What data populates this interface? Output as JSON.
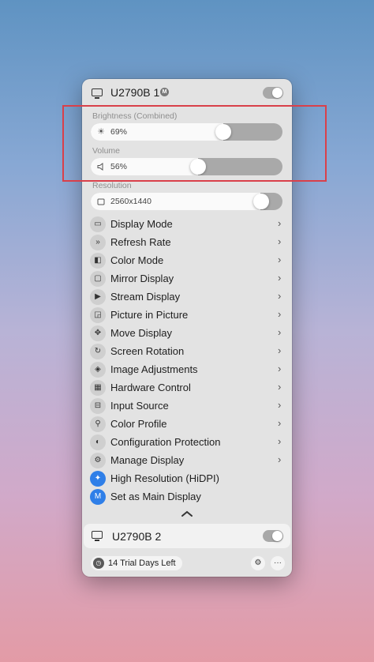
{
  "display1": {
    "name": "U2790B 1",
    "badge": "M",
    "enabled": true
  },
  "brightness": {
    "label": "Brightness (Combined)",
    "value_text": "69%",
    "level": 0.69,
    "icon": "sun-icon"
  },
  "volume": {
    "label": "Volume",
    "value_text": "56%",
    "level": 0.56,
    "icon": "speaker-icon"
  },
  "resolution": {
    "label": "Resolution",
    "value_text": "2560x1440",
    "icon": "resolution-icon"
  },
  "menu": [
    {
      "label": "Display Mode",
      "icon": "display-mode-icon",
      "glyph": "▭",
      "submenu": true
    },
    {
      "label": "Refresh Rate",
      "icon": "refresh-rate-icon",
      "glyph": "»",
      "submenu": true
    },
    {
      "label": "Color Mode",
      "icon": "color-mode-icon",
      "glyph": "◧",
      "submenu": true
    },
    {
      "label": "Mirror Display",
      "icon": "mirror-display-icon",
      "glyph": "▢",
      "submenu": true
    },
    {
      "label": "Stream Display",
      "icon": "stream-display-icon",
      "glyph": "▶",
      "submenu": true
    },
    {
      "label": "Picture in Picture",
      "icon": "picture-in-picture-icon",
      "glyph": "◲",
      "submenu": true
    },
    {
      "label": "Move Display",
      "icon": "move-display-icon",
      "glyph": "✥",
      "submenu": true
    },
    {
      "label": "Screen Rotation",
      "icon": "screen-rotation-icon",
      "glyph": "↻",
      "submenu": true
    },
    {
      "label": "Image Adjustments",
      "icon": "image-adjustments-icon",
      "glyph": "◈",
      "submenu": true
    },
    {
      "label": "Hardware Control",
      "icon": "hardware-control-icon",
      "glyph": "▦",
      "submenu": true
    },
    {
      "label": "Input Source",
      "icon": "input-source-icon",
      "glyph": "⊟",
      "submenu": true
    },
    {
      "label": "Color Profile",
      "icon": "color-profile-icon",
      "glyph": "⚲",
      "submenu": true
    },
    {
      "label": "Configuration Protection",
      "icon": "configuration-protection-icon",
      "glyph": "◐",
      "submenu": true
    },
    {
      "label": "Manage Display",
      "icon": "manage-display-icon",
      "glyph": "⚙",
      "submenu": true
    },
    {
      "label": "High Resolution (HiDPI)",
      "icon": "hidpi-icon",
      "glyph": "✦",
      "submenu": false,
      "accent": true
    },
    {
      "label": "Set as Main Display",
      "icon": "main-display-icon",
      "glyph": "M",
      "submenu": false,
      "accent": true
    }
  ],
  "display2": {
    "name": "U2790B 2",
    "enabled": true
  },
  "footer": {
    "trial_text": "14 Trial Days Left"
  },
  "colors": {
    "accent": "#2f7fe8",
    "highlight_box": "#d9404a"
  }
}
